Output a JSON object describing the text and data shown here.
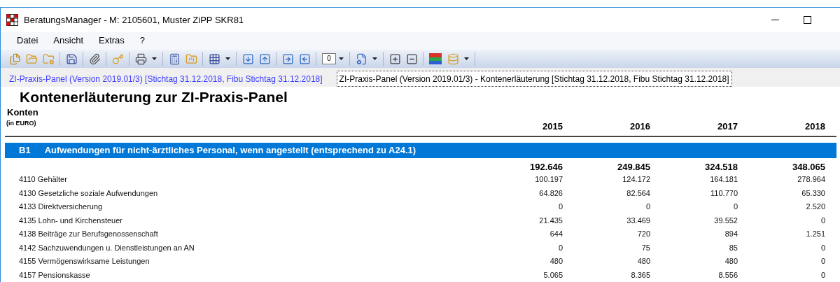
{
  "window": {
    "title": "BeratungsManager - M: 2105601, Muster ZiPP SKR81"
  },
  "menu": [
    "Datei",
    "Ansicht",
    "Extras",
    "?"
  ],
  "toolbar": {
    "zoom_value": "0"
  },
  "tabs": [
    {
      "label": "ZI-Praxis-Panel (Version 2019.01/3) [Stichtag 31.12.2018, Fibu Stichtag 31.12.2018]",
      "selected": false
    },
    {
      "label": "ZI-Praxis-Panel (Version 2019.01/3) - Kontenerläuterung [Stichtag 31.12.2018, Fibu Stichtag 31.12.2018]",
      "selected": true
    }
  ],
  "report": {
    "title": "Kontenerläuterung zur ZI-Praxis-Panel",
    "column_label": "Konten",
    "unit": "(in EURO)",
    "years": [
      "2015",
      "2016",
      "2017",
      "2018"
    ],
    "section": {
      "code": "B1",
      "title": "Aufwendungen für nicht-ärztliches Personal, wenn angestellt (entsprechend zu A24.1)",
      "totals": [
        "192.646",
        "249.845",
        "324.518",
        "348.065"
      ]
    },
    "rows": [
      {
        "account": "4110 Gehälter",
        "values": [
          "100.197",
          "124.172",
          "164.181",
          "278.964"
        ]
      },
      {
        "account": "4130 Gesetzliche soziale Aufwendungen",
        "values": [
          "64.826",
          "82.564",
          "110.770",
          "65.330"
        ]
      },
      {
        "account": "4133 Direktversicherung",
        "values": [
          "0",
          "0",
          "0",
          "2.520"
        ]
      },
      {
        "account": "4135 Lohn- und Kirchensteuer",
        "values": [
          "21.435",
          "33.469",
          "39.552",
          "0"
        ]
      },
      {
        "account": "4138 Beiträge zur Berufsgenossenschaft",
        "values": [
          "644",
          "720",
          "894",
          "1.251"
        ]
      },
      {
        "account": "4142 Sachzuwendungen u. Dienstleistungen an AN",
        "values": [
          "0",
          "75",
          "85",
          "0"
        ]
      },
      {
        "account": "4155 Vermögenswirksame Leistungen",
        "values": [
          "480",
          "480",
          "480",
          "0"
        ]
      },
      {
        "account": "4157 Pensionskasse",
        "values": [
          "5.065",
          "8.365",
          "8.556",
          "0"
        ]
      }
    ]
  }
}
